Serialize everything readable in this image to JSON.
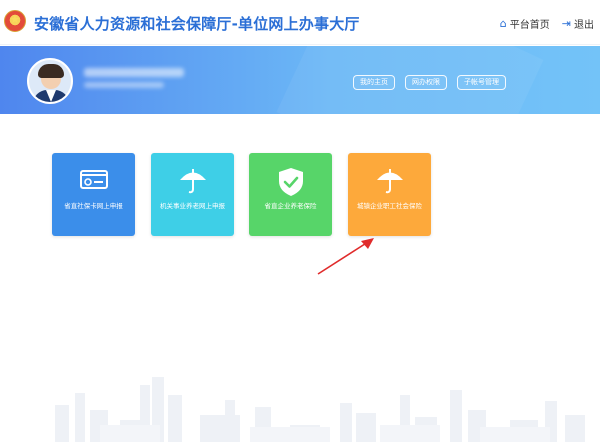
{
  "header": {
    "title": "安徽省人力资源和社会保障厅-单位网上办事大厅",
    "nav": [
      {
        "label": "平台首页",
        "icon": "home-icon"
      },
      {
        "label": "退出",
        "icon": "logout-icon"
      }
    ]
  },
  "banner": {
    "buttons": [
      {
        "label": "我的主页"
      },
      {
        "label": "网办权限"
      },
      {
        "label": "子帐号管理"
      }
    ]
  },
  "tiles": [
    {
      "label": "省直社保卡网上申报",
      "icon": "card-icon",
      "color": "#3b8eea"
    },
    {
      "label": "机关事业养老网上申报",
      "icon": "umbrella-icon",
      "color": "#3ecfe7"
    },
    {
      "label": "省直企业养老保险",
      "icon": "shield-check-icon",
      "color": "#57d569"
    },
    {
      "label": "城镇企业职工社会保险",
      "icon": "umbrella-icon",
      "color": "#fda93b"
    }
  ],
  "colors": {
    "title": "#2b6fd6",
    "banner_start": "#4f86ee",
    "banner_end": "#73c3f8",
    "arrow": "#e02b2b"
  }
}
